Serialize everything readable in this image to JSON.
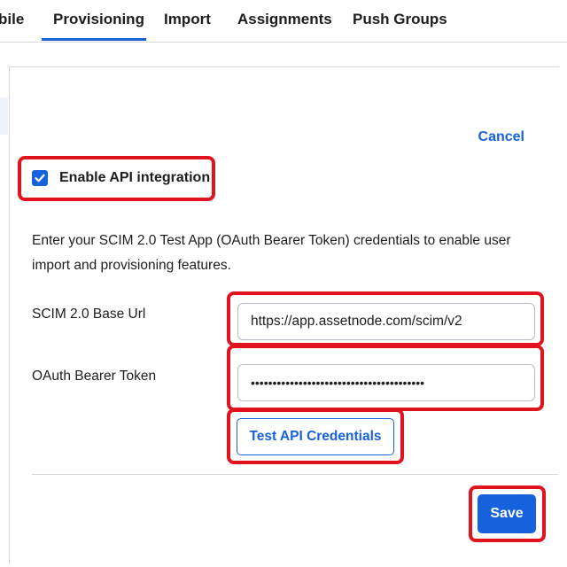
{
  "tabs": [
    {
      "label": "bile"
    },
    {
      "label": "Provisioning",
      "active": true
    },
    {
      "label": "Import"
    },
    {
      "label": "Assignments"
    },
    {
      "label": "Push Groups"
    }
  ],
  "form": {
    "cancel_label": "Cancel",
    "enable_api_label": "Enable API integration",
    "enable_api_checked": true,
    "description": "Enter your SCIM 2.0 Test App (OAuth Bearer Token) credentials to enable user import and provisioning features.",
    "base_url_label": "SCIM 2.0 Base Url",
    "base_url_value": "https://app.assetnode.com/scim/v2",
    "token_label": "OAuth Bearer Token",
    "token_value": "••••••••••••••••••••••••••••••••••••••••",
    "test_button_label": "Test API Credentials",
    "save_button_label": "Save"
  },
  "colors": {
    "accent": "#1662dd",
    "highlight": "#e0141e"
  },
  "icons": {
    "checkbox": "checkmark-icon"
  }
}
